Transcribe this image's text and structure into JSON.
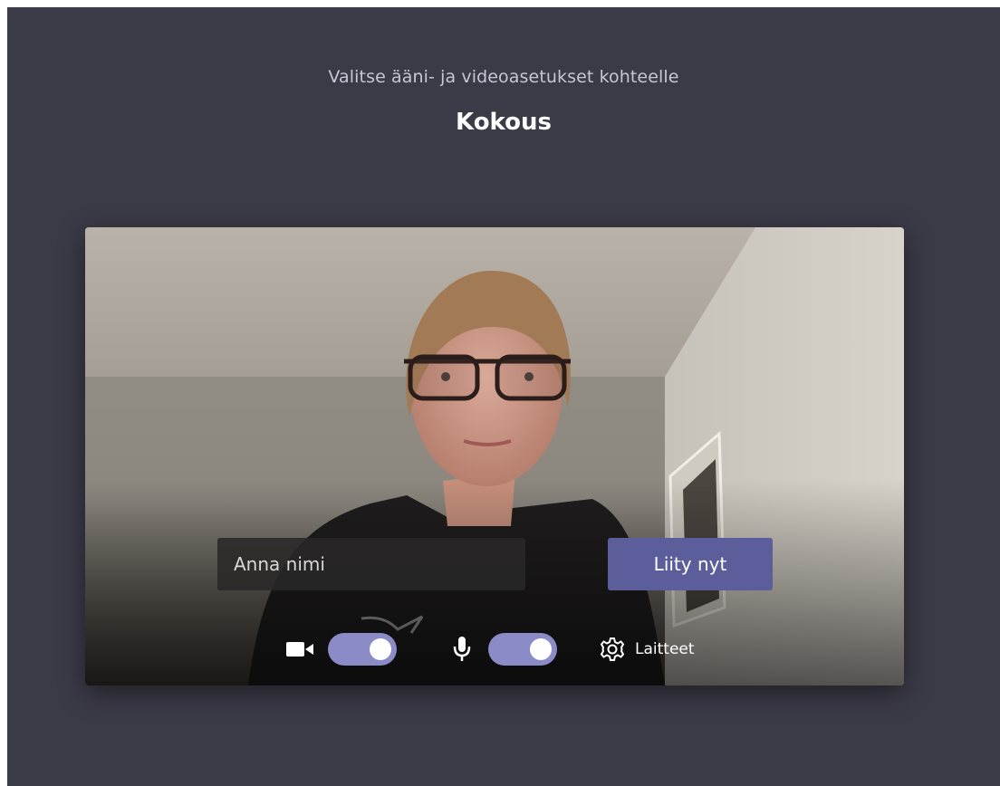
{
  "header": {
    "subtitle": "Valitse ääni- ja videoasetukset kohteelle",
    "meeting_title": "Kokous"
  },
  "join_form": {
    "name_placeholder": "Anna nimi",
    "join_label": "Liity nyt"
  },
  "controls": {
    "camera": {
      "icon": "video-camera-icon",
      "enabled": true
    },
    "microphone": {
      "icon": "microphone-icon",
      "enabled": true
    },
    "devices": {
      "icon": "gear-icon",
      "label": "Laitteet"
    }
  },
  "colors": {
    "background": "#3b3a47",
    "accent": "#5b5e9a",
    "toggle_on": "#8b8cc7"
  }
}
